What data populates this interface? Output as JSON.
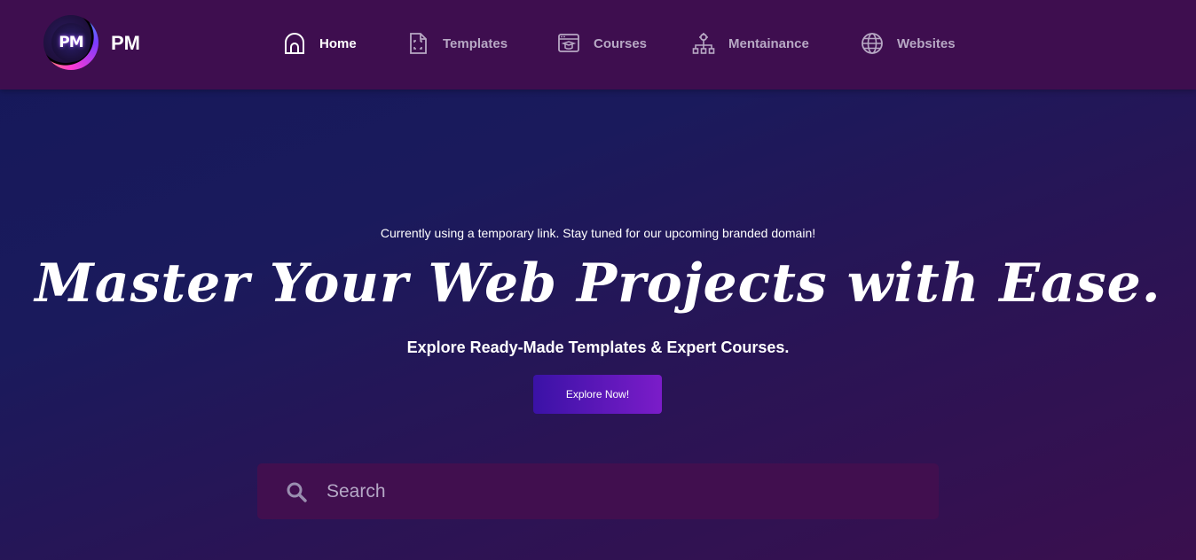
{
  "brand": {
    "logo_text": "PM",
    "name": "PM"
  },
  "nav": [
    {
      "label": "Home",
      "icon": "home-icon",
      "active": true
    },
    {
      "label": "Templates",
      "icon": "template-file-icon",
      "active": false
    },
    {
      "label": "Courses",
      "icon": "course-browser-icon",
      "active": false
    },
    {
      "label": "Mentainance",
      "icon": "maintenance-network-icon",
      "active": false
    },
    {
      "label": "Websites",
      "icon": "globe-icon",
      "active": false
    }
  ],
  "hero": {
    "notice": "Currently using a temporary link. Stay tuned for our upcoming branded domain!",
    "headline": "Master Your Web Projects with Ease.",
    "subheadline": "Explore Ready-Made Templates & Expert Courses.",
    "cta_label": "Explore Now!"
  },
  "search": {
    "placeholder": "Search",
    "value": ""
  },
  "colors": {
    "navbar": "#3e0e4f",
    "search_box": "#410f4f",
    "cta_start": "#3a12a6",
    "cta_end": "#7b1cc9",
    "nav_inactive": "#b7a8c4"
  }
}
